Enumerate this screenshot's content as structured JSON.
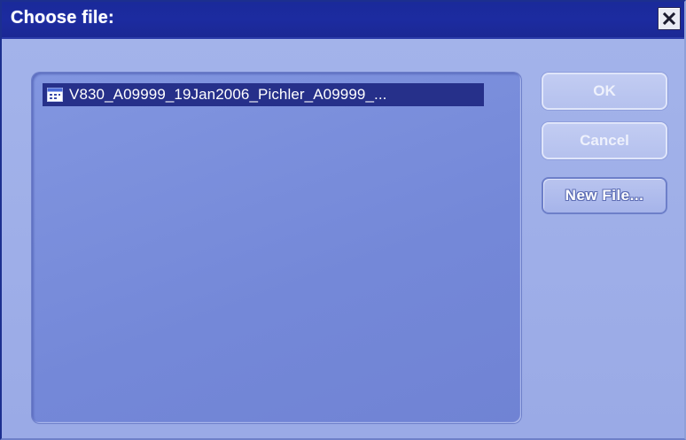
{
  "dialog": {
    "title": "Choose file:",
    "close_icon": "close-icon"
  },
  "file_list": {
    "items": [
      {
        "name": "V830_A09999_19Jan2006_Pichler_A09999_...",
        "icon": "document-icon",
        "selected": true
      }
    ]
  },
  "buttons": {
    "ok_label": "OK",
    "cancel_label": "Cancel",
    "new_file_label": "New File..."
  },
  "colors": {
    "title_bar": "#1c2ba0",
    "dialog_background": "#9aaae4",
    "list_background": "#7a8ddc",
    "selection": "#26308a"
  }
}
